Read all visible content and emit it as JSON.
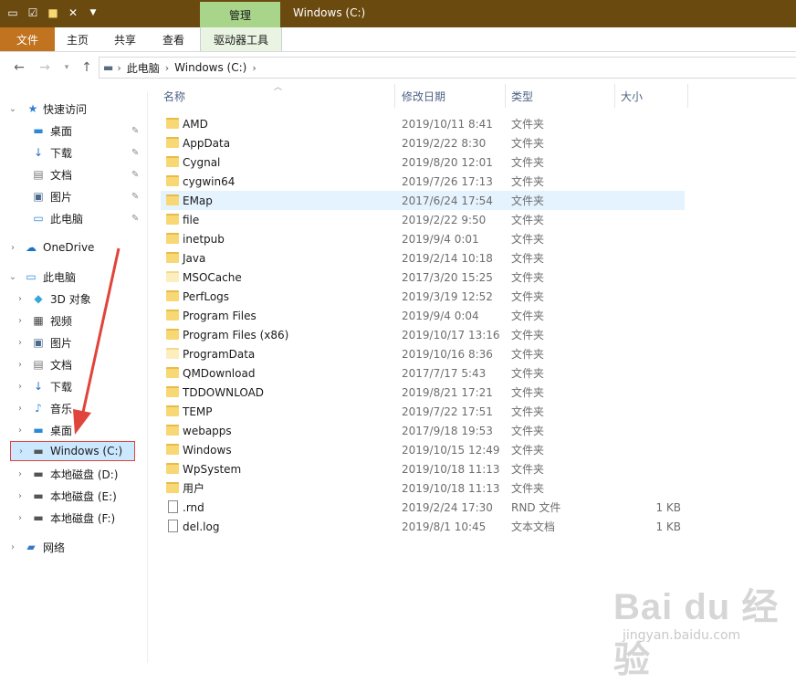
{
  "titlebar": {
    "title": "Windows (C:)",
    "context_tab": "管理",
    "qat_icons": [
      "drive-icon",
      "properties-icon",
      "new-folder-icon",
      "delete-icon",
      "qat-dropdown-icon"
    ]
  },
  "ribbon": {
    "tabs": [
      "文件",
      "主页",
      "共享",
      "查看",
      "驱动器工具"
    ]
  },
  "address": {
    "crumbs": [
      "此电脑",
      "Windows (C:)"
    ]
  },
  "columns": [
    "名称",
    "修改日期",
    "类型",
    "大小"
  ],
  "sidebar": {
    "items": [
      {
        "label": "快速访问",
        "icon": "star-icon"
      },
      {
        "label": "桌面",
        "icon": "desktop-icon",
        "pinned": true
      },
      {
        "label": "下载",
        "icon": "download-icon",
        "pinned": true
      },
      {
        "label": "文档",
        "icon": "document-icon",
        "pinned": true
      },
      {
        "label": "图片",
        "icon": "picture-icon",
        "pinned": true
      },
      {
        "label": "此电脑",
        "icon": "pc-icon",
        "pinned": true
      },
      {
        "label": "OneDrive",
        "icon": "cloud-icon"
      },
      {
        "label": "此电脑",
        "icon": "pc-icon"
      },
      {
        "label": "3D 对象",
        "icon": "cube-icon"
      },
      {
        "label": "视频",
        "icon": "video-icon"
      },
      {
        "label": "图片",
        "icon": "picture-icon"
      },
      {
        "label": "文档",
        "icon": "document-icon"
      },
      {
        "label": "下载",
        "icon": "download-icon"
      },
      {
        "label": "音乐",
        "icon": "music-icon"
      },
      {
        "label": "桌面",
        "icon": "desktop-icon"
      },
      {
        "label": "Windows (C:)",
        "icon": "drive-icon",
        "selected": true
      },
      {
        "label": "本地磁盘 (D:)",
        "icon": "drive-icon"
      },
      {
        "label": "本地磁盘 (E:)",
        "icon": "drive-icon"
      },
      {
        "label": "本地磁盘 (F:)",
        "icon": "drive-icon"
      },
      {
        "label": "网络",
        "icon": "network-icon"
      }
    ]
  },
  "files": [
    {
      "name": "AMD",
      "date": "2019/10/11 8:41",
      "type": "文件夹",
      "size": "",
      "kind": "folder"
    },
    {
      "name": "AppData",
      "date": "2019/2/22 8:30",
      "type": "文件夹",
      "size": "",
      "kind": "folder"
    },
    {
      "name": "Cygnal",
      "date": "2019/8/20 12:01",
      "type": "文件夹",
      "size": "",
      "kind": "folder"
    },
    {
      "name": "cygwin64",
      "date": "2019/7/26 17:13",
      "type": "文件夹",
      "size": "",
      "kind": "folder"
    },
    {
      "name": "EMap",
      "date": "2017/6/24 17:54",
      "type": "文件夹",
      "size": "",
      "kind": "folder",
      "highlight": true
    },
    {
      "name": "file",
      "date": "2019/2/22 9:50",
      "type": "文件夹",
      "size": "",
      "kind": "folder"
    },
    {
      "name": "inetpub",
      "date": "2019/9/4 0:01",
      "type": "文件夹",
      "size": "",
      "kind": "folder"
    },
    {
      "name": "Java",
      "date": "2019/2/14 10:18",
      "type": "文件夹",
      "size": "",
      "kind": "folder"
    },
    {
      "name": "MSOCache",
      "date": "2017/3/20 15:25",
      "type": "文件夹",
      "size": "",
      "kind": "folder-pale"
    },
    {
      "name": "PerfLogs",
      "date": "2019/3/19 12:52",
      "type": "文件夹",
      "size": "",
      "kind": "folder"
    },
    {
      "name": "Program Files",
      "date": "2019/9/4 0:04",
      "type": "文件夹",
      "size": "",
      "kind": "folder"
    },
    {
      "name": "Program Files (x86)",
      "date": "2019/10/17 13:16",
      "type": "文件夹",
      "size": "",
      "kind": "folder"
    },
    {
      "name": "ProgramData",
      "date": "2019/10/16 8:36",
      "type": "文件夹",
      "size": "",
      "kind": "folder-pale"
    },
    {
      "name": "QMDownload",
      "date": "2017/7/17 5:43",
      "type": "文件夹",
      "size": "",
      "kind": "folder"
    },
    {
      "name": "TDDOWNLOAD",
      "date": "2019/8/21 17:21",
      "type": "文件夹",
      "size": "",
      "kind": "folder"
    },
    {
      "name": "TEMP",
      "date": "2019/7/22 17:51",
      "type": "文件夹",
      "size": "",
      "kind": "folder"
    },
    {
      "name": "webapps",
      "date": "2017/9/18 19:53",
      "type": "文件夹",
      "size": "",
      "kind": "folder"
    },
    {
      "name": "Windows",
      "date": "2019/10/15 12:49",
      "type": "文件夹",
      "size": "",
      "kind": "folder"
    },
    {
      "name": "WpSystem",
      "date": "2019/10/18 11:13",
      "type": "文件夹",
      "size": "",
      "kind": "folder"
    },
    {
      "name": "用户",
      "date": "2019/10/18 11:13",
      "type": "文件夹",
      "size": "",
      "kind": "folder"
    },
    {
      "name": ".rnd",
      "date": "2019/2/24 17:30",
      "type": "RND 文件",
      "size": "1 KB",
      "kind": "file"
    },
    {
      "name": "del.log",
      "date": "2019/8/1 10:45",
      "type": "文本文档",
      "size": "1 KB",
      "kind": "file"
    }
  ],
  "watermark": {
    "main": "Bai du 经验",
    "sub": "jingyan.baidu.com"
  },
  "colors": {
    "titlebar": "#6b4a10",
    "file_tab": "#c27320",
    "manage_tab": "#a8d58a",
    "selection": "#cce8ff",
    "annotation_red": "#e0443a",
    "folder": "#f8d775"
  }
}
